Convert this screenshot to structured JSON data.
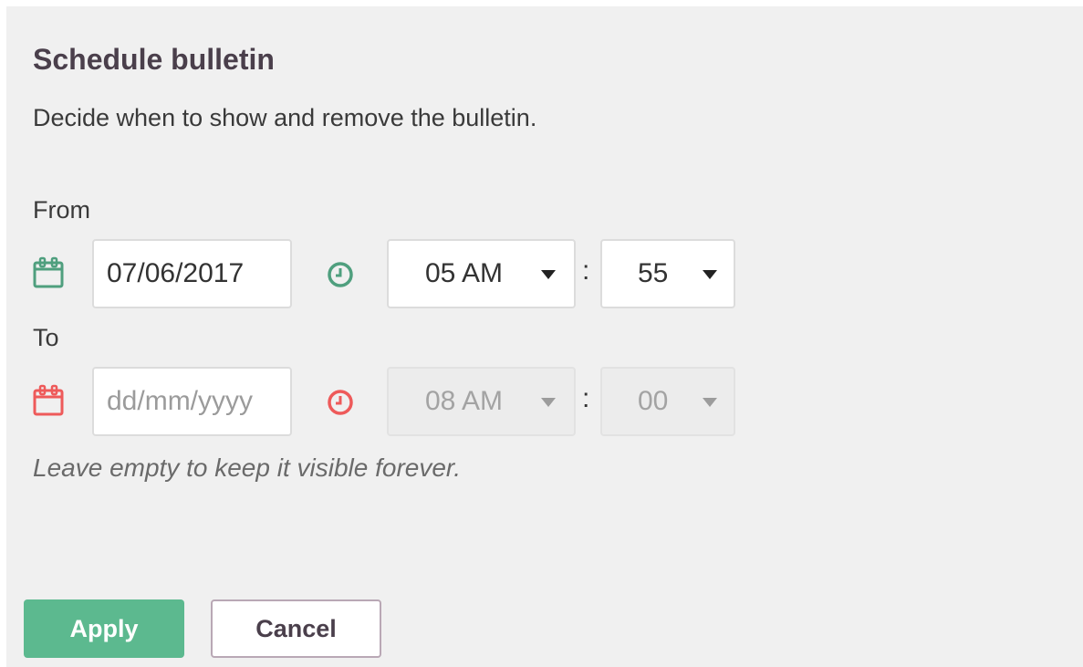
{
  "dialog": {
    "title": "Schedule bulletin",
    "subtitle": "Decide when to show and remove the bulletin."
  },
  "from": {
    "label": "From",
    "date_value": "07/06/2017",
    "hour": "05 AM",
    "minute": "55",
    "separator": ":",
    "icon_color": "#4f9f7e"
  },
  "to": {
    "label": "To",
    "date_placeholder": "dd/mm/yyyy",
    "hour": "08 AM",
    "minute": "00",
    "separator": ":",
    "icon_color": "#ee5a5a"
  },
  "hint": "Leave empty to keep it visible forever.",
  "actions": {
    "apply_label": "Apply",
    "cancel_label": "Cancel"
  },
  "colors": {
    "accent": "#5cb98f",
    "panel_bg": "#f0f0f0"
  }
}
